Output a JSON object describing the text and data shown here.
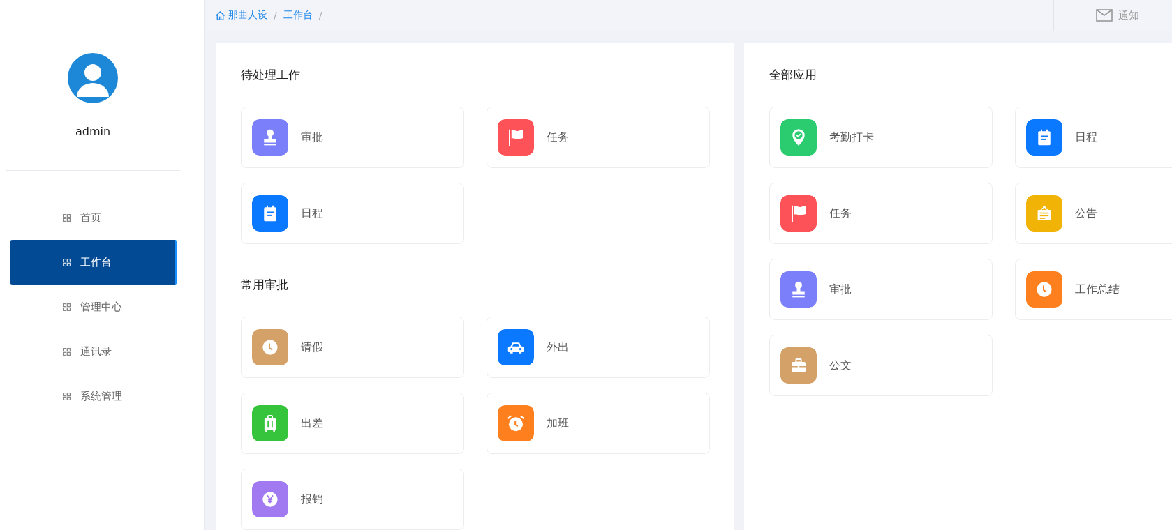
{
  "sidebar": {
    "user": {
      "name": "admin"
    },
    "items": [
      {
        "label": "首页",
        "selected": false
      },
      {
        "label": "工作台",
        "selected": true
      },
      {
        "label": "管理中心",
        "selected": false
      },
      {
        "label": "通讯录",
        "selected": false
      },
      {
        "label": "系统管理",
        "selected": false
      }
    ]
  },
  "header": {
    "breadcrumb": [
      {
        "label": "那曲人设",
        "separator": "/",
        "home": true
      },
      {
        "label": "工作台",
        "separator": "/",
        "home": false
      }
    ],
    "notification": {
      "label": "通知"
    }
  },
  "panels": [
    {
      "sections": [
        {
          "title": "待处理工作",
          "items": [
            {
              "label": "审批",
              "kind": "stamp",
              "color": "#7b7ff9"
            },
            {
              "label": "任务",
              "kind": "flag",
              "color": "#fd5257"
            },
            {
              "label": "日程",
              "kind": "calendar",
              "color": "#0a78ff"
            }
          ]
        },
        {
          "title": "常用审批",
          "items": [
            {
              "label": "请假",
              "kind": "clock",
              "color": "#d4a269"
            },
            {
              "label": "外出",
              "kind": "car",
              "color": "#0a78ff"
            },
            {
              "label": "出差",
              "kind": "suitcase",
              "color": "#35c43c"
            },
            {
              "label": "加班",
              "kind": "alarm",
              "color": "#fd7f1d"
            },
            {
              "label": "报销",
              "kind": "yen",
              "color": "#a17af1"
            }
          ]
        }
      ]
    },
    {
      "sections": [
        {
          "title": "全部应用",
          "items": [
            {
              "label": "考勤打卡",
              "kind": "pin",
              "color": "#2bcc70"
            },
            {
              "label": "日程",
              "kind": "calendar",
              "color": "#0a78ff"
            },
            {
              "label": "任务",
              "kind": "flag",
              "color": "#fd5257"
            },
            {
              "label": "公告",
              "kind": "notice",
              "color": "#f1b306"
            },
            {
              "label": "审批",
              "kind": "stamp",
              "color": "#7b7ff9"
            },
            {
              "label": "工作总结",
              "kind": "clock",
              "color": "#fd7f1d"
            },
            {
              "label": "公文",
              "kind": "briefcase",
              "color": "#d4a269"
            }
          ]
        }
      ]
    }
  ]
}
